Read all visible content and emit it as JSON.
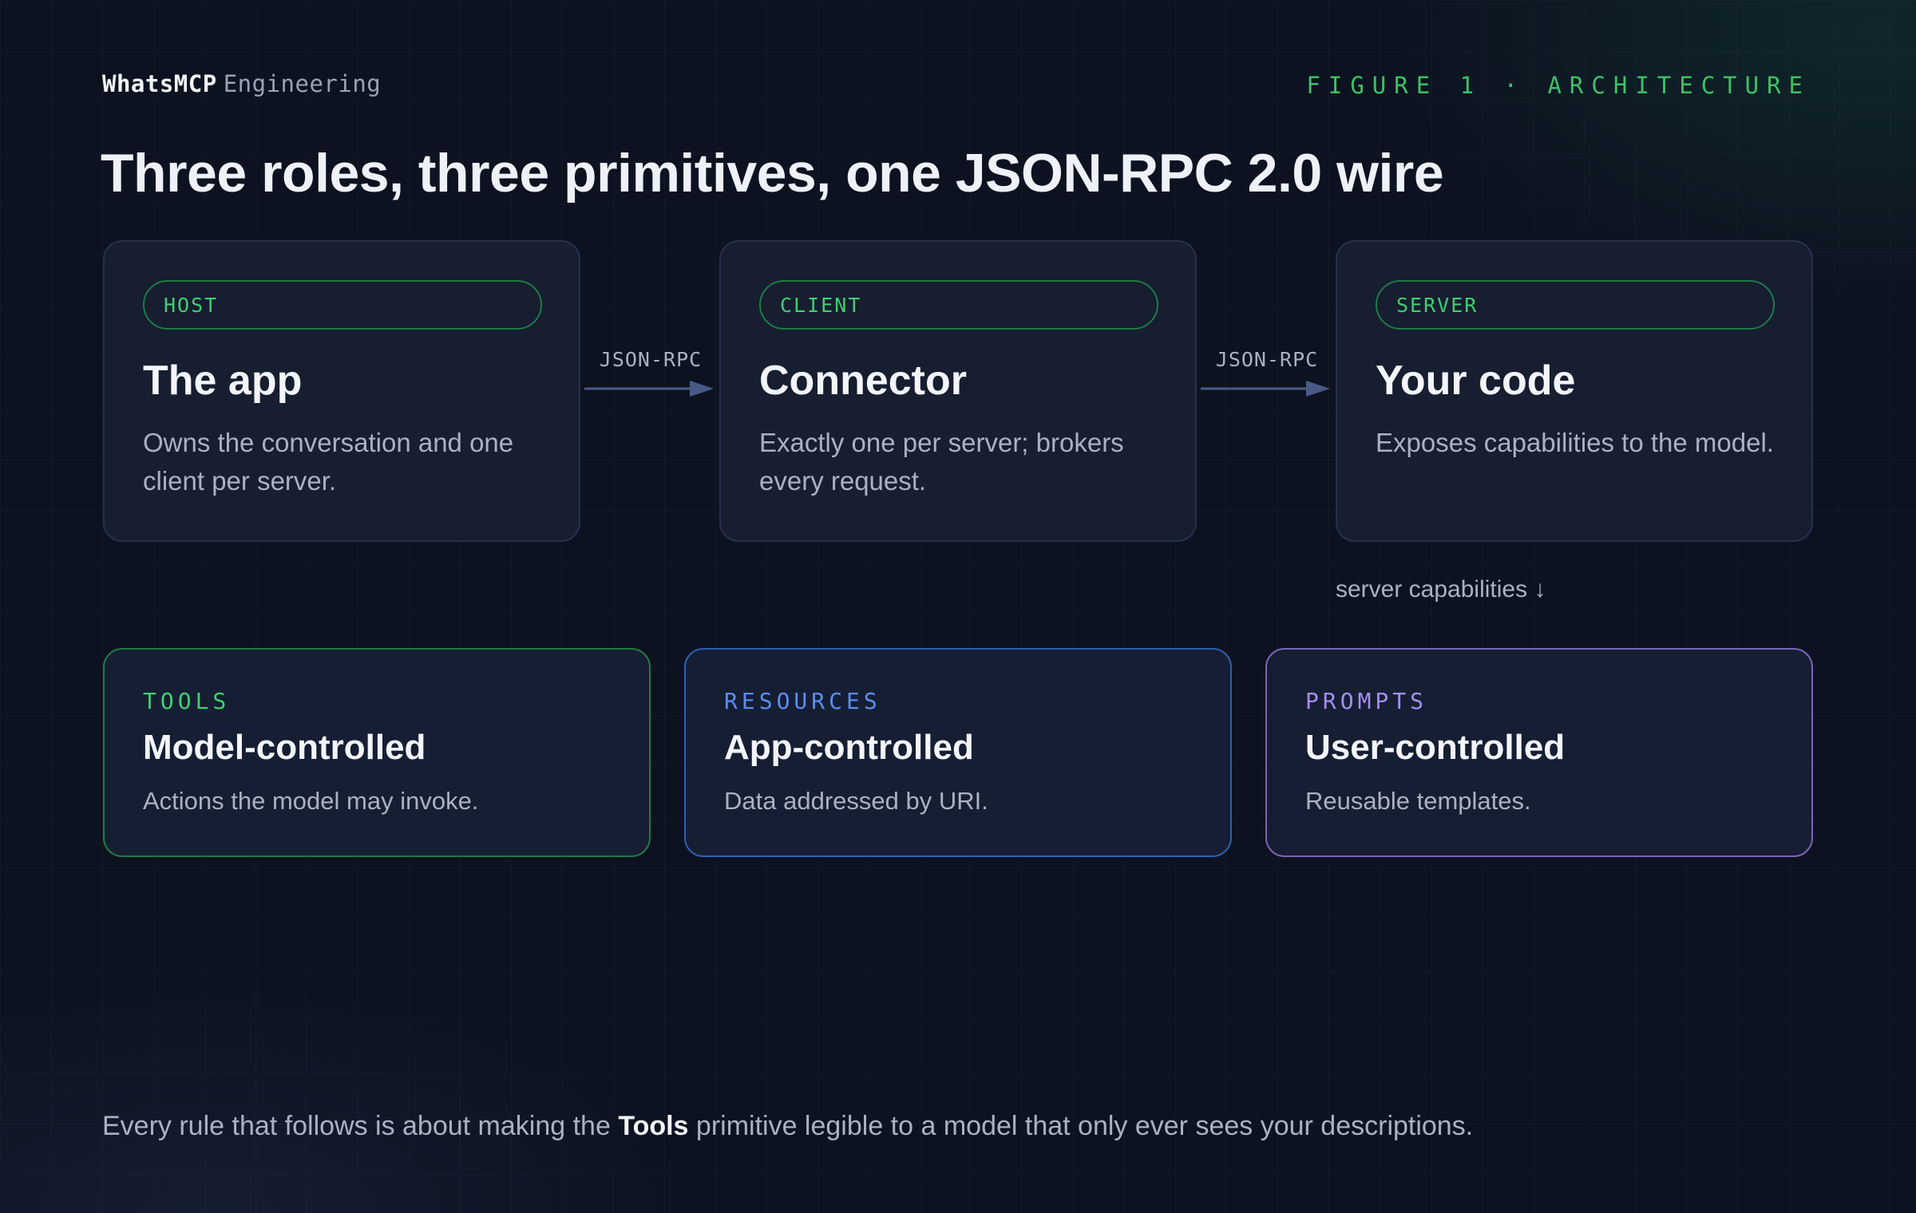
{
  "header": {
    "brand_name": "WhatsMCP",
    "brand_sub": "Engineering",
    "figure_label": "FIGURE 1 · ARCHITECTURE"
  },
  "title": "Three roles, three primitives, one JSON-RPC 2.0 wire",
  "roles": [
    {
      "tag": "HOST",
      "title": "The app",
      "description": "Owns the conversation and one client per server."
    },
    {
      "tag": "CLIENT",
      "title": "Connector",
      "description": "Exactly one per server; brokers every request."
    },
    {
      "tag": "SERVER",
      "title": "Your code",
      "description": "Exposes capabilities to the model."
    }
  ],
  "connectors": [
    {
      "label": "JSON-RPC"
    },
    {
      "label": "JSON-RPC"
    }
  ],
  "capabilities_note": "server capabilities ↓",
  "primitives": [
    {
      "tag": "TOOLS",
      "title": "Model-controlled",
      "description": "Actions the model may invoke.",
      "accent": "#3fcf70"
    },
    {
      "tag": "RESOURCES",
      "title": "App-controlled",
      "description": "Data addressed by URI.",
      "accent": "#5b8ef0"
    },
    {
      "tag": "PROMPTS",
      "title": "User-controlled",
      "description": "Reusable templates.",
      "accent": "#a48ef0"
    }
  ],
  "footer": {
    "before": "Every rule that follows is about making the ",
    "emphasis": "Tools",
    "after": " primitive legible to a model that only ever sees your descriptions."
  },
  "colors": {
    "background": "#0c1220",
    "card": "#161e30",
    "green_accent": "#3fbf66",
    "arrow": "#4a5a86"
  }
}
